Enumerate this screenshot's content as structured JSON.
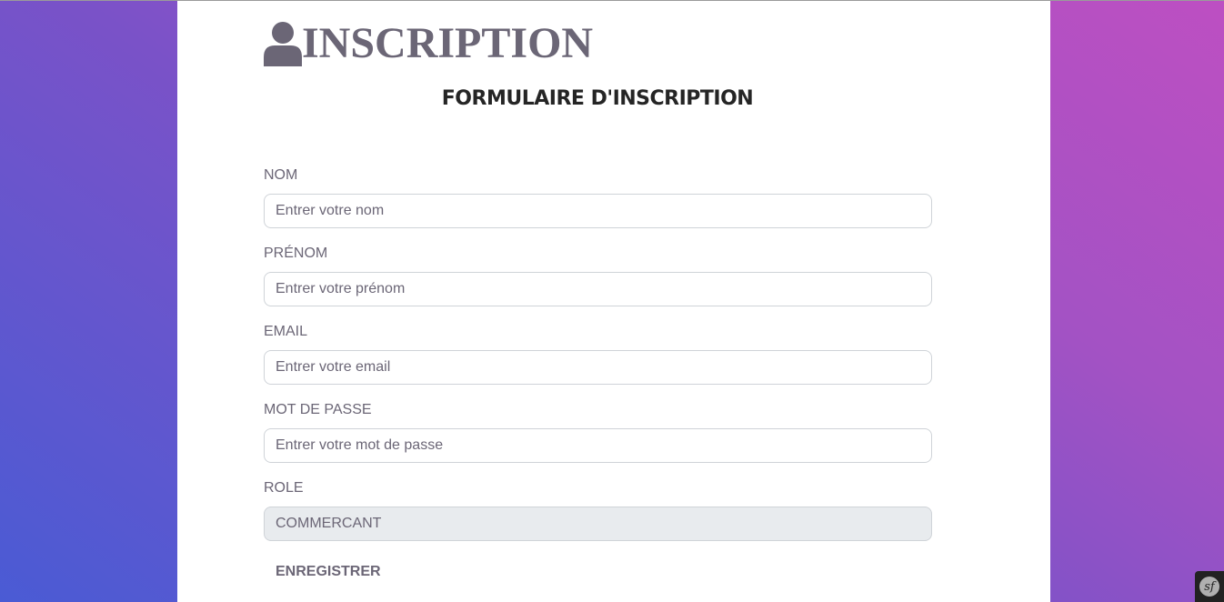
{
  "brand": {
    "title": "INSCRIPTION",
    "icon": "user-icon"
  },
  "form": {
    "title": "FORMULAIRE D'INSCRIPTION",
    "fields": [
      {
        "label": "NOM",
        "placeholder": "Entrer votre nom",
        "value": ""
      },
      {
        "label": "PRÉNOM",
        "placeholder": "Entrer votre prénom",
        "value": ""
      },
      {
        "label": "EMAIL",
        "placeholder": "Entrer votre email",
        "value": ""
      },
      {
        "label": "MOT DE PASSE",
        "placeholder": "Entrer votre mot de passe",
        "value": ""
      },
      {
        "label": "ROLE",
        "placeholder": "",
        "value": "COMMERCANT"
      }
    ],
    "submit_label": "ENREGISTRER"
  },
  "toolbar": {
    "icon": "symfony-icon",
    "glyph": "sf"
  },
  "colors": {
    "gradient_start": "#4a5bd4",
    "gradient_end": "#bd4fc2",
    "text_muted": "#6b6676",
    "title_dark": "#252525",
    "readonly_bg": "#e8ebee"
  }
}
